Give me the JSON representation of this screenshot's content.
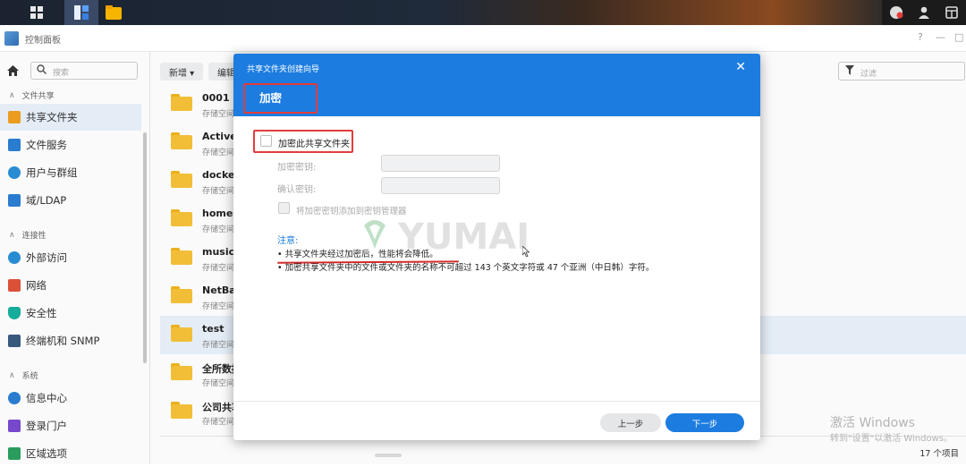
{
  "taskbar": {
    "right_icons": [
      "chat-icon",
      "user-icon",
      "widgets-icon"
    ]
  },
  "window": {
    "title": "控制面板",
    "controls": [
      "?",
      "—",
      "□"
    ]
  },
  "sidebar": {
    "search_placeholder": "搜索",
    "sections": [
      {
        "label": "文件共享"
      },
      {
        "label": "连接性"
      },
      {
        "label": "系统"
      }
    ],
    "items": [
      {
        "label": "共享文件夹",
        "icon": "shared-folder-icon",
        "color": "#f0a020"
      },
      {
        "label": "文件服务",
        "icon": "file-services-icon",
        "color": "#2a7fd4"
      },
      {
        "label": "用户与群组",
        "icon": "users-icon",
        "color": "#2a8fd8"
      },
      {
        "label": "域/LDAP",
        "icon": "domain-icon",
        "color": "#2a7fd4"
      },
      {
        "label": "外部访问",
        "icon": "external-access-icon",
        "color": "#2a8fd8"
      },
      {
        "label": "网络",
        "icon": "network-icon",
        "color": "#e0533a"
      },
      {
        "label": "安全性",
        "icon": "security-icon",
        "color": "#16b0a0"
      },
      {
        "label": "终端机和 SNMP",
        "icon": "terminal-icon",
        "color": "#3a5a80"
      },
      {
        "label": "信息中心",
        "icon": "info-center-icon",
        "color": "#2a7fd4"
      },
      {
        "label": "登录门户",
        "icon": "login-portal-icon",
        "color": "#7a4ad0"
      },
      {
        "label": "区域选项",
        "icon": "regional-options-icon",
        "color": "#2aa060"
      }
    ]
  },
  "main": {
    "toolbar": {
      "create": "新增 ▾",
      "edit": "编辑"
    },
    "filter_placeholder": "过滤",
    "folders": [
      {
        "name": "0001",
        "sub": "存储空间"
      },
      {
        "name": "ActiveB",
        "sub": "存储空间"
      },
      {
        "name": "docker",
        "sub": "存储空间"
      },
      {
        "name": "homes",
        "sub": "存储空间"
      },
      {
        "name": "music",
        "sub": "存储空间"
      },
      {
        "name": "NetBac",
        "sub": "存储空间"
      },
      {
        "name": "test",
        "sub": "存储空间"
      },
      {
        "name": "全所数据",
        "sub": "存储空间"
      },
      {
        "name": "公司共享",
        "sub": "存储空间"
      }
    ],
    "count": "17 个项目"
  },
  "dialog": {
    "title": "共享文件夹创建向导",
    "step": "加密",
    "encrypt_checkbox": "加密此共享文件夹",
    "key_label": "加密密钥:",
    "confirm_label": "确认密钥:",
    "key_manager_label": "将加密密钥添加到密钥管理器",
    "note_title": "注意:",
    "note_1": "• 共享文件夹经过加密后，性能将会降低。",
    "note_2": "• 加密共享文件夹中的文件或文件夹的名称不可超过 143 个英文字符或 47 个亚洲（中日韩）字符。",
    "prev": "上一步",
    "next": "下一步"
  },
  "watermark": {
    "activate": "激活 Windows",
    "activate_sub": "转到\"设置\"以激活 Windows。",
    "logo_text": "YUMAI"
  }
}
